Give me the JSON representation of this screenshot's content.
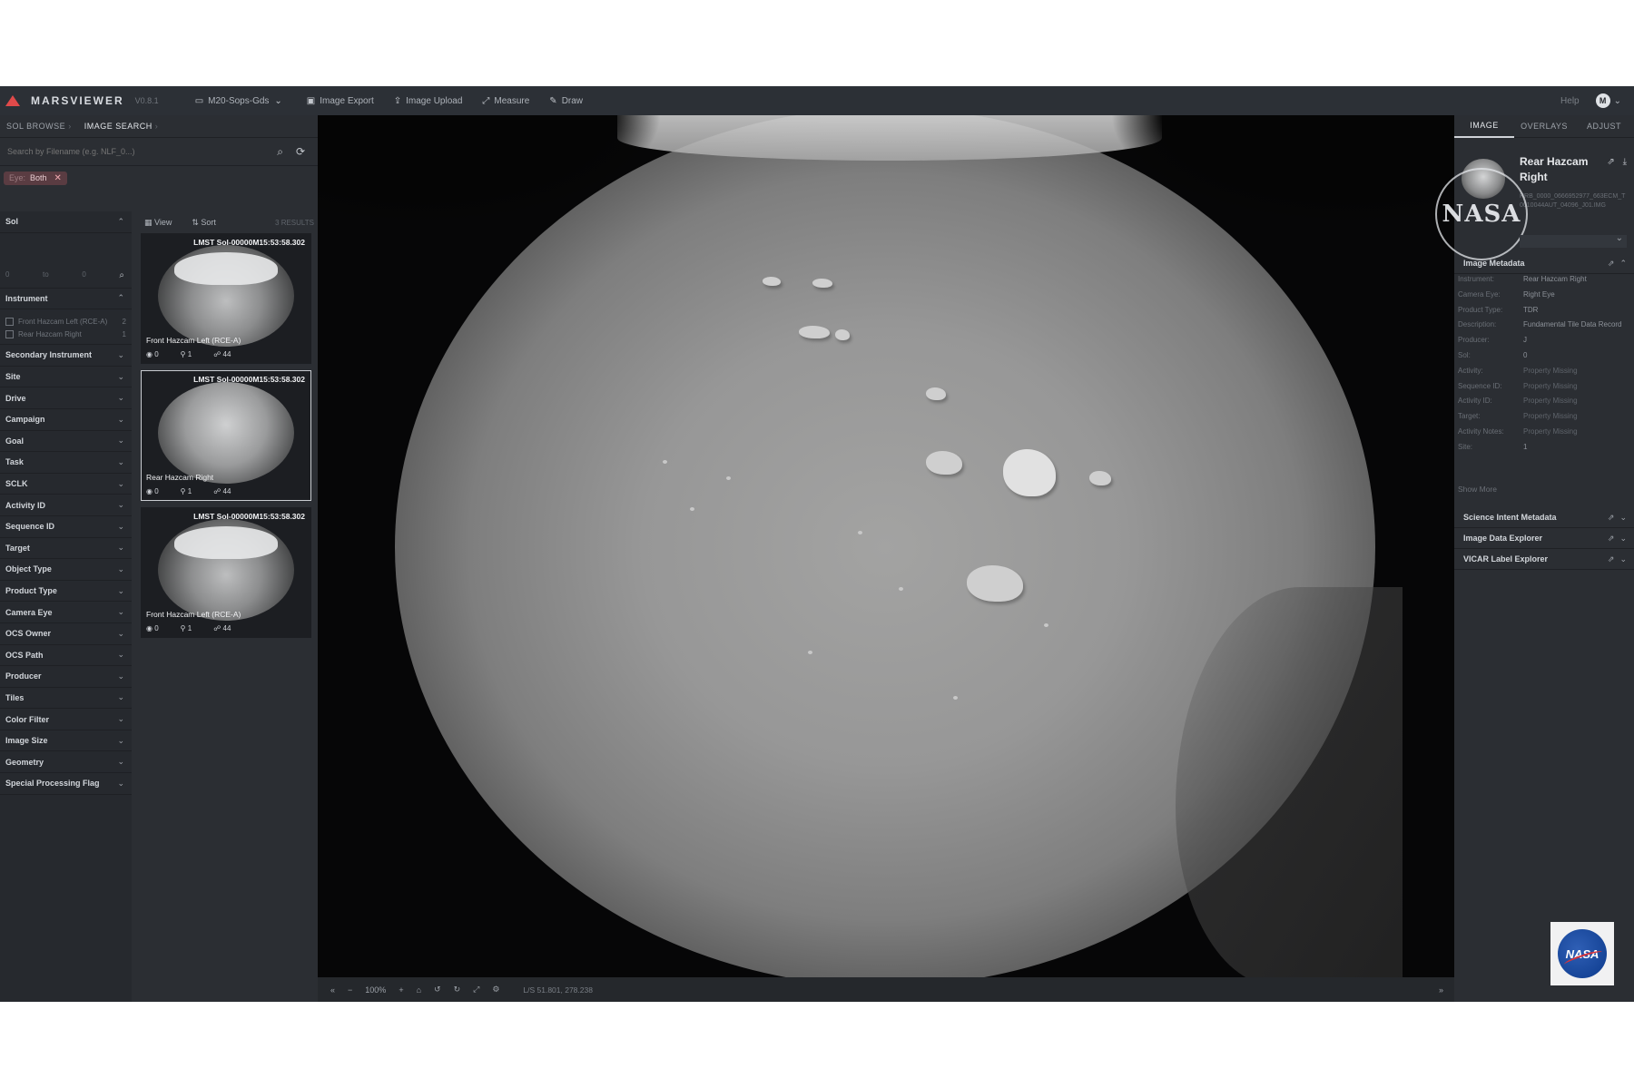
{
  "topbar": {
    "app_name": "MARSVIEWER",
    "version": "V0.8.1",
    "items": [
      {
        "icon": "folder-icon",
        "label": "M20-Sops-Gds",
        "has_dropdown": true
      },
      {
        "icon": "image-export-icon",
        "label": "Image Export"
      },
      {
        "icon": "upload-icon",
        "label": "Image Upload"
      },
      {
        "icon": "measure-icon",
        "label": "Measure"
      },
      {
        "icon": "pencil-icon",
        "label": "Draw"
      }
    ],
    "help_label": "Help",
    "user_initial": "M"
  },
  "left": {
    "tabs": [
      "SOL BROWSE",
      "IMAGE SEARCH"
    ],
    "active_tab": 1,
    "search_placeholder": "Search by Filename (e.g. NLF_0...)",
    "chip": {
      "key": "Eye:",
      "value": "Both"
    },
    "filters": {
      "sol_label": "Sol",
      "sol_range": {
        "from": "0",
        "to_label": "to",
        "to": "0"
      },
      "instrument_label": "Instrument",
      "instrument_options": [
        {
          "label": "Front Hazcam Left (RCE-A)",
          "count": "2"
        },
        {
          "label": "Rear Hazcam Right",
          "count": "1"
        }
      ],
      "sections": [
        "Secondary Instrument",
        "Site",
        "Drive",
        "Campaign",
        "Goal",
        "Task",
        "SCLK",
        "Activity ID",
        "Sequence ID",
        "Target",
        "Object Type",
        "Product Type",
        "Camera Eye",
        "OCS Owner",
        "OCS Path",
        "Producer",
        "Tiles",
        "Color Filter",
        "Image Size",
        "Geometry",
        "Special Processing Flag"
      ]
    },
    "results_header": {
      "view_label": "View",
      "sort_label": "Sort",
      "count": "3 RESULTS"
    },
    "cards": [
      {
        "timestamp": "LMST Sol-00000M15:53:58.302",
        "label": "Front Hazcam Left (RCE-A)",
        "views": "0",
        "pins": "1",
        "people": "44",
        "selected": false
      },
      {
        "timestamp": "LMST Sol-00000M15:53:58.302",
        "label": "Rear Hazcam Right",
        "views": "0",
        "pins": "1",
        "people": "44",
        "selected": true
      },
      {
        "timestamp": "LMST Sol-00000M15:53:58.302",
        "label": "Front Hazcam Left (RCE-A)",
        "views": "0",
        "pins": "1",
        "people": "44",
        "selected": false
      }
    ]
  },
  "bottombar": {
    "zoom": "100%",
    "coords": "L/S  51.801, 278.238"
  },
  "right": {
    "tabs": [
      "IMAGE",
      "OVERLAYS",
      "ADJUST"
    ],
    "active_tab": 0,
    "title": "Rear Hazcam Right",
    "filename": "RRB_0000_0666952977_663ECM_T0010044AUT_04096_J01.IMG",
    "seal_text": "NASA",
    "metadata_title": "Image Metadata",
    "metadata": [
      {
        "k": "Instrument:",
        "v": "Rear Hazcam Right"
      },
      {
        "k": "Camera Eye:",
        "v": "Right Eye"
      },
      {
        "k": "Product Type:",
        "v": "TDR"
      },
      {
        "k": "Description:",
        "v": "Fundamental Tile Data Record"
      },
      {
        "k": "Producer:",
        "v": "J"
      },
      {
        "k": "Sol:",
        "v": "0"
      },
      {
        "k": "Activity:",
        "v": "Property Missing",
        "missing": true
      },
      {
        "k": "Sequence ID:",
        "v": "Property Missing",
        "missing": true
      },
      {
        "k": "Activity ID:",
        "v": "Property Missing",
        "missing": true
      },
      {
        "k": "Target:",
        "v": "Property Missing",
        "missing": true
      },
      {
        "k": "Activity Notes:",
        "v": "Property Missing",
        "missing": true
      },
      {
        "k": "Site:",
        "v": "1"
      }
    ],
    "show_more": "Show More",
    "sections": [
      "Science Intent Metadata",
      "Image Data Explorer",
      "VICAR Label Explorer"
    ]
  },
  "watermark": {
    "text": "NASA"
  }
}
